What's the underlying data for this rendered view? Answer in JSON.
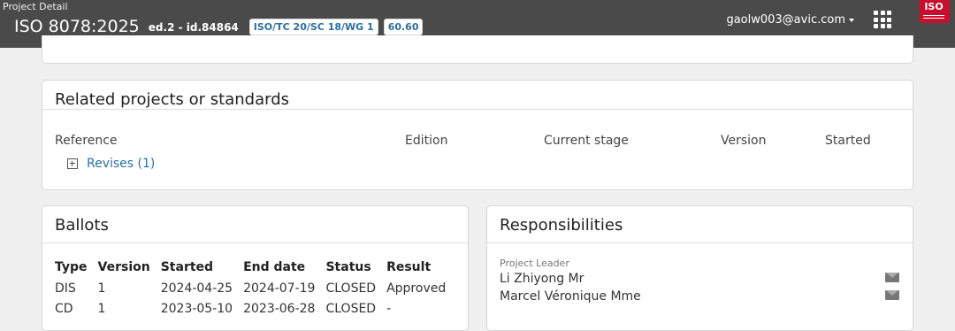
{
  "header": {
    "subtitle": "Project Detail",
    "title": "ISO 8078:2025",
    "edition": "ed.2 - id.84864",
    "committee_badge": "ISO/TC 20/SC 18/WG 1",
    "stage_badge": "60.60",
    "user": "gaolw003@avic.com",
    "logo_text": "ISO",
    "icons": [
      "chevron-down-icon",
      "apps-grid-icon",
      "iso-logo"
    ]
  },
  "related": {
    "title": "Related projects or standards",
    "columns": [
      "Reference",
      "Edition",
      "Current stage",
      "Version",
      "Started"
    ],
    "revises_label": "Revises (1)"
  },
  "ballots": {
    "title": "Ballots",
    "columns": [
      "Type",
      "Version",
      "Started",
      "End date",
      "Status",
      "Result"
    ],
    "rows": [
      {
        "type": "DIS",
        "version": "1",
        "started": "2024-04-25",
        "end_date": "2024-07-19",
        "status": "CLOSED",
        "result": "Approved"
      },
      {
        "type": "CD",
        "version": "1",
        "started": "2023-05-10",
        "end_date": "2023-06-28",
        "status": "CLOSED",
        "result": "-"
      }
    ]
  },
  "responsibilities": {
    "title": "Responsibilities",
    "role": "Project Leader",
    "people": [
      "Li Zhiyong Mr",
      "Marcel Véronique Mme"
    ]
  },
  "colors": {
    "header_bg": "#4a4a4a",
    "link": "#2f6e9c",
    "iso_red": "#c8102e"
  }
}
